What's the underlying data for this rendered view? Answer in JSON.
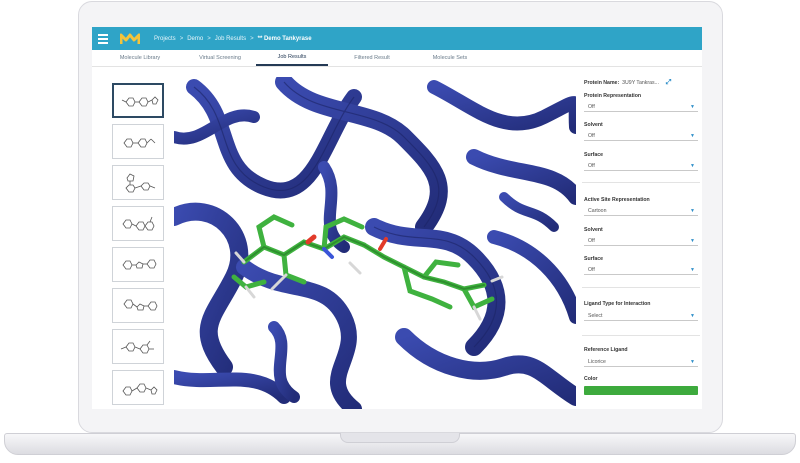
{
  "topbar": {
    "breadcrumb": [
      "Projects",
      "Demo",
      "Job Results"
    ],
    "separator": ">",
    "current": "** Demo Tankyrase",
    "accent_color": "#2fa4c7"
  },
  "tabs": [
    {
      "label": "Molecule Library"
    },
    {
      "label": "Virtual Screening"
    },
    {
      "label": "Job Results"
    },
    {
      "label": "Filtered Result"
    },
    {
      "label": "Molecule Sets"
    }
  ],
  "active_tab": "Job Results",
  "panel": {
    "protein_name_label": "Protein Name:",
    "protein_name_value": "3U9Y Tankras...",
    "protein_representation": {
      "label": "Protein Representation",
      "value": "Off"
    },
    "solvent_1": {
      "label": "Solvent",
      "value": "Off"
    },
    "surface_1": {
      "label": "Surface",
      "value": "Off"
    },
    "active_site_representation": {
      "label": "Active Site Representation",
      "value": "Cartoon"
    },
    "solvent_2": {
      "label": "Solvent",
      "value": "Off"
    },
    "surface_2": {
      "label": "Surface",
      "value": "Off"
    },
    "ligand_type": {
      "label": "Ligand Type for Interaction",
      "value": "Select"
    },
    "reference_ligand": {
      "label": "Reference Ligand",
      "value": "Licorice"
    },
    "color_label": "Color",
    "color_value": "#3daa3d"
  },
  "viewer": {
    "protein_color": "#2e3a94",
    "ligand_color": "#3fb23f"
  }
}
